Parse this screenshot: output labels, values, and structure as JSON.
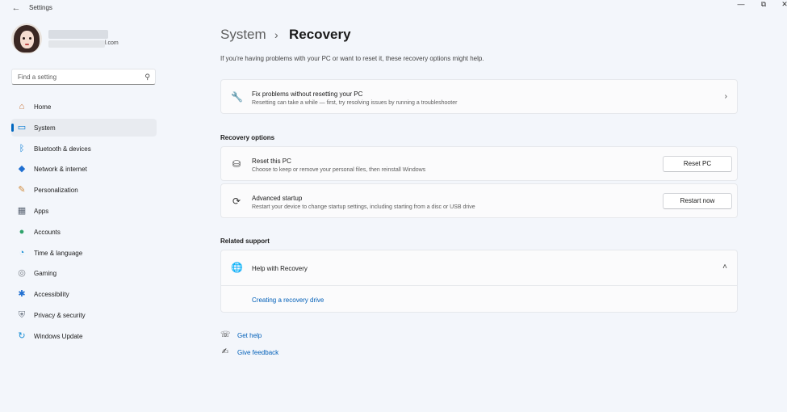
{
  "window": {
    "title": "Settings",
    "back_glyph": "←",
    "controls": {
      "minimize": "—",
      "restore": "⧉",
      "close": "✕"
    }
  },
  "account": {
    "email_suffix": "l.com"
  },
  "search": {
    "placeholder": "Find a setting",
    "icon_glyph": "⚲"
  },
  "nav": {
    "items": [
      {
        "label": "Home",
        "icon": "home-icon",
        "glyph": "⌂",
        "color": "#c8733a"
      },
      {
        "label": "System",
        "icon": "system-icon",
        "glyph": "▭",
        "color": "#0078d4",
        "active": true
      },
      {
        "label": "Bluetooth & devices",
        "icon": "bluetooth-icon",
        "glyph": "ᛒ",
        "color": "#0078d4"
      },
      {
        "label": "Network & internet",
        "icon": "network-icon",
        "glyph": "◆",
        "color": "#1f6fd1"
      },
      {
        "label": "Personalization",
        "icon": "brush-icon",
        "glyph": "✎",
        "color": "#d08a3c"
      },
      {
        "label": "Apps",
        "icon": "apps-icon",
        "glyph": "▦",
        "color": "#5a6473"
      },
      {
        "label": "Accounts",
        "icon": "accounts-icon",
        "glyph": "●",
        "color": "#2ea36b"
      },
      {
        "label": "Time & language",
        "icon": "globe-clock-icon",
        "glyph": "◔",
        "color": "#1b8fd6"
      },
      {
        "label": "Gaming",
        "icon": "gamepad-icon",
        "glyph": "◎",
        "color": "#7a7f87"
      },
      {
        "label": "Accessibility",
        "icon": "accessibility-icon",
        "glyph": "✱",
        "color": "#1f6fd1"
      },
      {
        "label": "Privacy & security",
        "icon": "shield-icon",
        "glyph": "⛨",
        "color": "#6b7480"
      },
      {
        "label": "Windows Update",
        "icon": "update-icon",
        "glyph": "↻",
        "color": "#1b8fd6"
      }
    ]
  },
  "main": {
    "breadcrumb": {
      "parent": "System",
      "separator": "›",
      "current": "Recovery"
    },
    "intro": "If you're having problems with your PC or want to reset it, these recovery options might help.",
    "troubleshoot": {
      "title": "Fix problems without resetting your PC",
      "subtitle": "Resetting can take a while — first, try resolving issues by running a troubleshooter",
      "glyph": "🔧",
      "chevron": "›"
    },
    "recovery_options": {
      "heading": "Recovery options",
      "reset": {
        "title": "Reset this PC",
        "subtitle": "Choose to keep or remove your personal files, then reinstall Windows",
        "button": "Reset PC",
        "glyph": "⛁"
      },
      "advanced": {
        "title": "Advanced startup",
        "subtitle": "Restart your device to change startup settings, including starting from a disc or USB drive",
        "button": "Restart now",
        "glyph": "⟳"
      }
    },
    "related_support": {
      "heading": "Related support",
      "help": {
        "title": "Help with Recovery",
        "glyph": "🌐",
        "chevron": "˄",
        "link": "Creating a recovery drive"
      }
    },
    "footer": {
      "get_help": "Get help",
      "give_feedback": "Give feedback",
      "get_help_glyph": "☏",
      "feedback_glyph": "✍"
    }
  }
}
